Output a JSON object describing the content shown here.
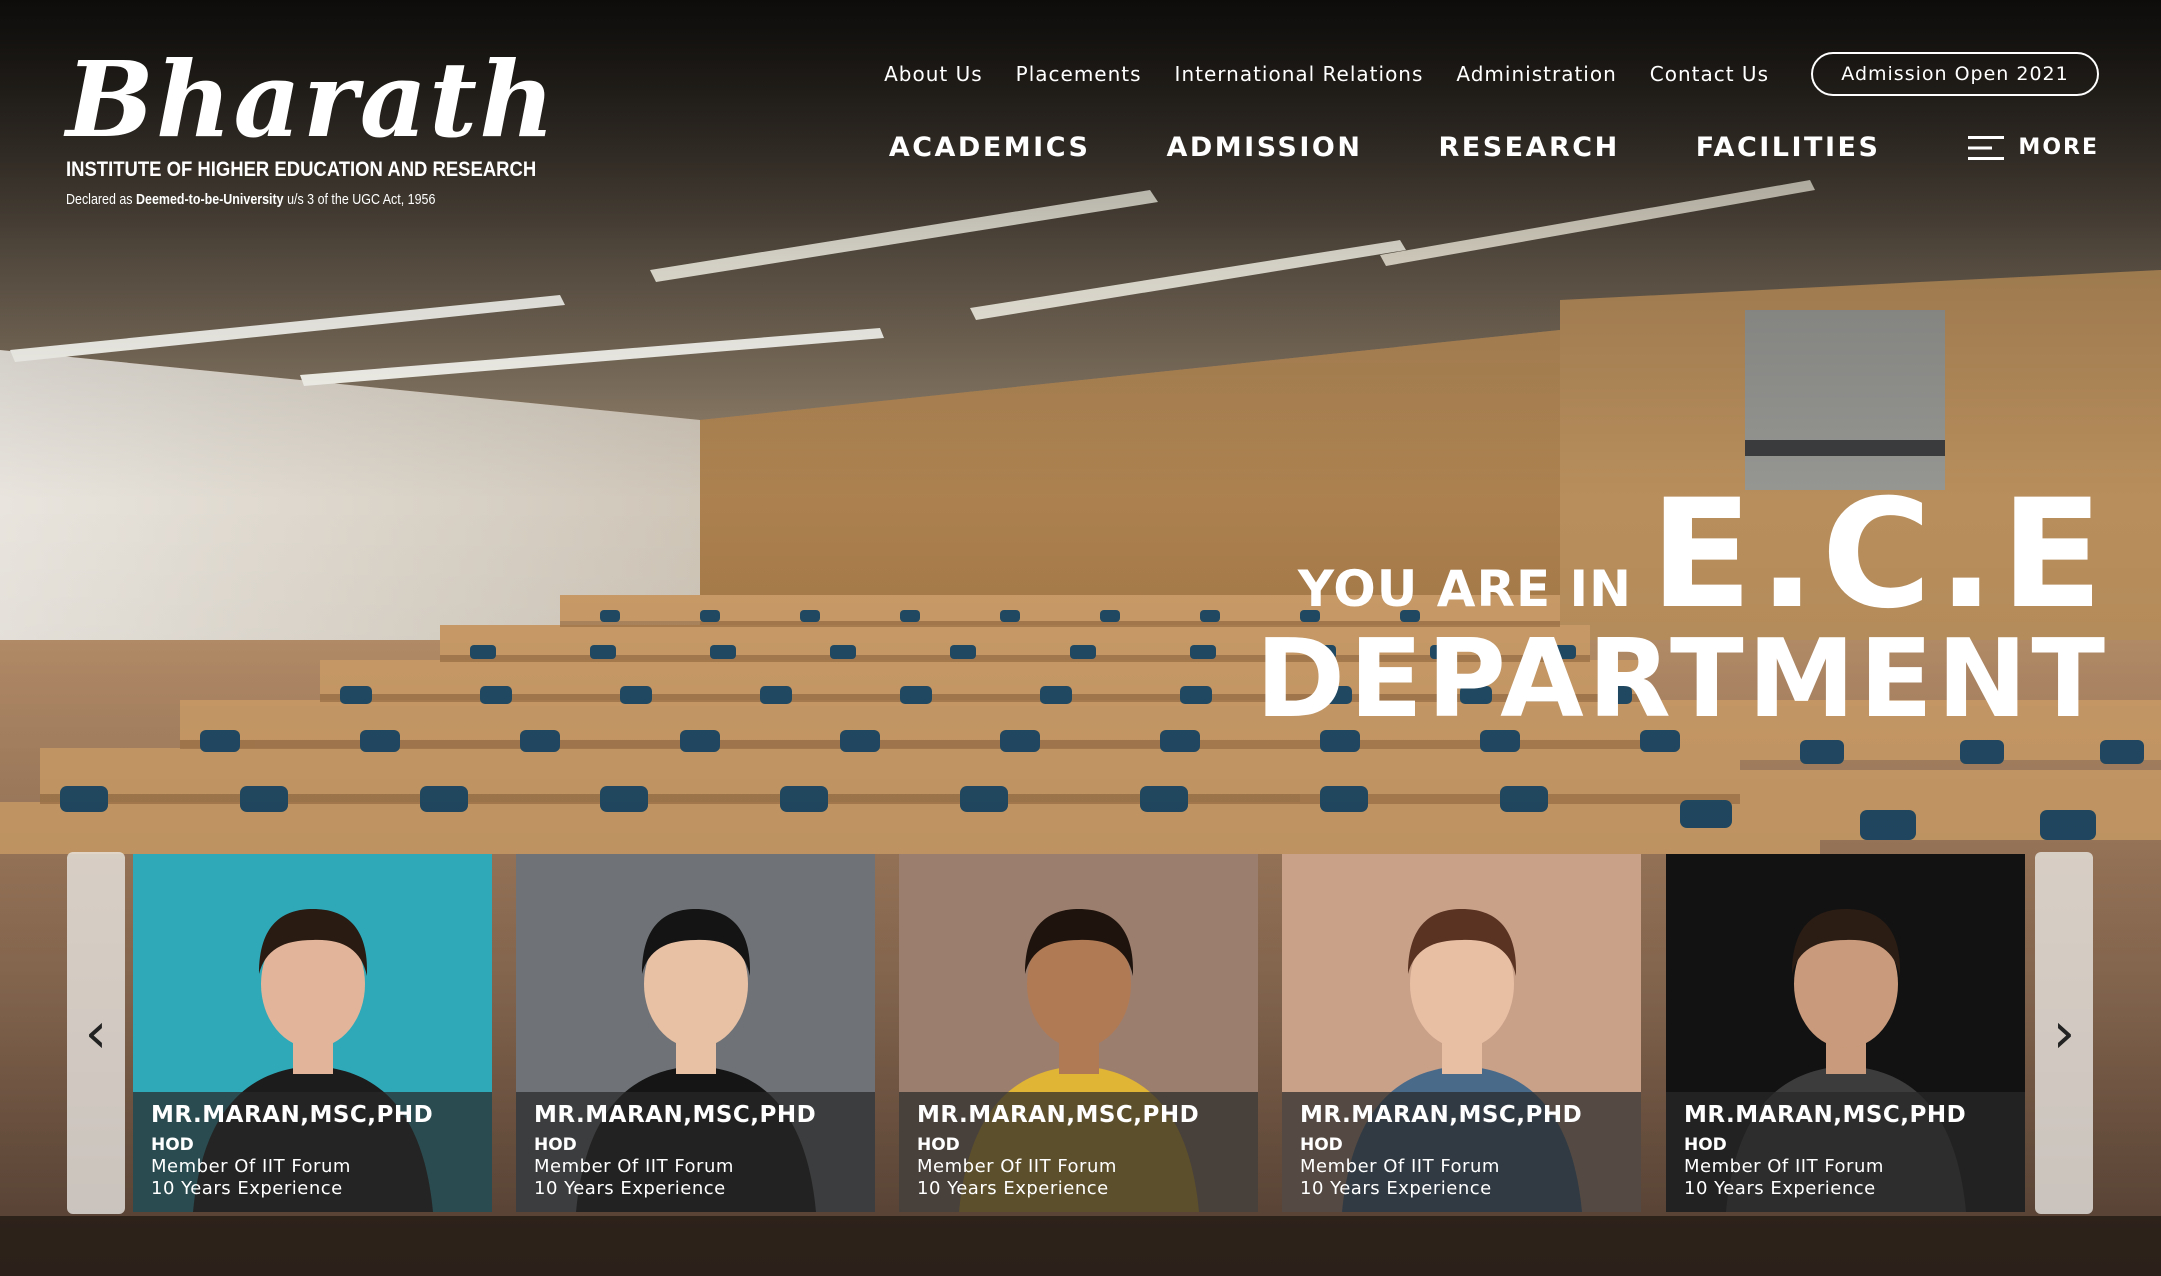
{
  "logo": {
    "name": "Bharath",
    "subtitle": "INSTITUTE OF HIGHER EDUCATION AND RESEARCH",
    "declaration_pre": "Declared as ",
    "declaration_bold": "Deemed-to-be-University",
    "declaration_post": " u/s 3 of the UGC Act, 1956"
  },
  "top_nav": {
    "items": [
      "About Us",
      "Placements",
      "International Relations",
      "Administration",
      "Contact Us"
    ],
    "admission_button": "Admission Open 2021"
  },
  "main_nav": {
    "items": [
      "ACADEMICS",
      "ADMISSION",
      "RESEARCH",
      "FACILITIES"
    ],
    "more_label": "MORE",
    "more_icon": "hamburger-icon"
  },
  "hero": {
    "prefix": "YOU ARE IN",
    "department": "E.C.E",
    "line2": "DEPARTMENT"
  },
  "carousel": {
    "prev_icon": "chevron-left-icon",
    "next_icon": "chevron-right-icon",
    "prev_glyph": "‹",
    "next_glyph": "›",
    "cards": [
      {
        "name": "MR.MARAN,MSC,PHD",
        "role": "HOD",
        "line1": "Member Of IIT Forum",
        "line2": "10 Years Experience",
        "bg": "#2fa9b8",
        "skin": "#e2b59a",
        "hair": "#2a1b12",
        "cloth": "#1c1c1c"
      },
      {
        "name": "MR.MARAN,MSC,PHD",
        "role": "HOD",
        "line1": "Member Of IIT Forum",
        "line2": "10 Years Experience",
        "bg": "#6f7377",
        "skin": "#e8c1a5",
        "hair": "#141414",
        "cloth": "#151515"
      },
      {
        "name": "MR.MARAN,MSC,PHD",
        "role": "HOD",
        "line1": "Member Of IIT Forum",
        "line2": "10 Years Experience",
        "bg": "#9c7e6e",
        "skin": "#b07a55",
        "hair": "#1f140d",
        "cloth": "#e0b435"
      },
      {
        "name": "MR.MARAN,MSC,PHD",
        "role": "HOD",
        "line1": "Member Of IIT Forum",
        "line2": "10 Years Experience",
        "bg": "#c9a189",
        "skin": "#e9bfa4",
        "hair": "#5a3322",
        "cloth": "#4a6a8a"
      },
      {
        "name": "MR.MARAN,MSC,PHD",
        "role": "HOD",
        "line1": "Member Of IIT Forum",
        "line2": "10 Years Experience",
        "bg": "#121212",
        "skin": "#c99a7b",
        "hair": "#2b1d14",
        "cloth": "#3c3c3c"
      }
    ]
  }
}
